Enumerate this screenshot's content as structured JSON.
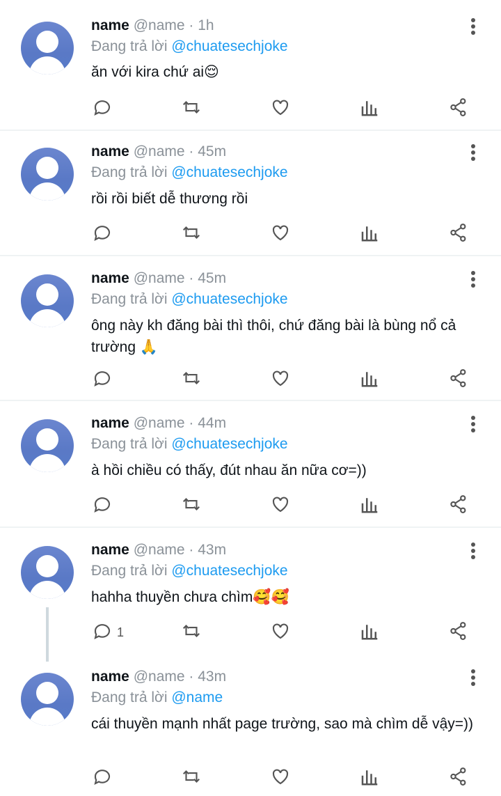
{
  "tweets": [
    {
      "name": "name",
      "handle": "@name",
      "time": "1h",
      "reply_prefix": "Đang trả lời",
      "reply_to": "@chuatesechjoke",
      "text": "ăn với kira chứ ai😌",
      "reply_count": ""
    },
    {
      "name": "name",
      "handle": "@name",
      "time": "45m",
      "reply_prefix": "Đang trả lời",
      "reply_to": "@chuatesechjoke",
      "text": "rồi rồi biết dễ thương rồi",
      "reply_count": ""
    },
    {
      "name": "name",
      "handle": "@name",
      "time": "45m",
      "reply_prefix": "Đang trả lời",
      "reply_to": "@chuatesechjoke",
      "text": "ông này kh đăng bài thì thôi, chứ đăng bài là bùng nổ cả trường 🙏",
      "reply_count": ""
    },
    {
      "name": "name",
      "handle": "@name",
      "time": "44m",
      "reply_prefix": "Đang trả lời",
      "reply_to": "@chuatesechjoke",
      "text": "à hồi chiều có thấy, đút nhau ăn nữa cơ=))",
      "reply_count": ""
    },
    {
      "name": "name",
      "handle": "@name",
      "time": "43m",
      "reply_prefix": "Đang trả lời",
      "reply_to": "@chuatesechjoke",
      "text": "hahha thuyền chưa chìm🥰🥰",
      "reply_count": "1"
    },
    {
      "name": "name",
      "handle": "@name",
      "time": "43m",
      "reply_prefix": "Đang trả lời",
      "reply_to": "@name",
      "text": "cái thuyền mạnh nhất page trường, sao mà chìm dễ vậy=))",
      "reply_count": ""
    }
  ],
  "separator": "·",
  "icons": [
    "reply-icon",
    "retweet-icon",
    "like-icon",
    "analytics-icon",
    "share-icon",
    "more-icon"
  ],
  "colors": {
    "link": "#1d9bf0",
    "muted": "#8a9198",
    "avatar": "#5a79c6"
  }
}
